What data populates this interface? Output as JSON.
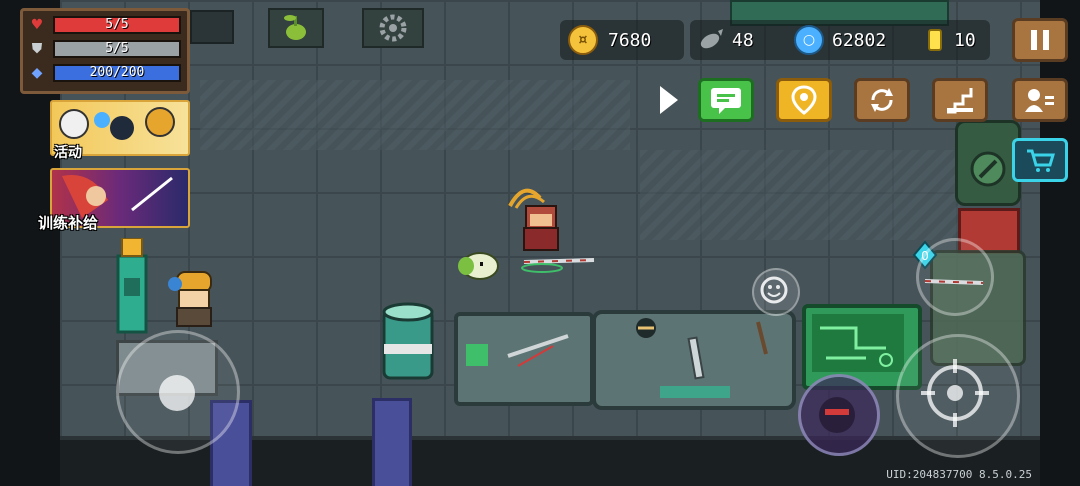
{
  "stats": {
    "hp": {
      "text": "5/5",
      "fraction": 1.0,
      "color": "#e03b3b",
      "icon": "heart-icon"
    },
    "armor": {
      "text": "5/5",
      "fraction": 1.0,
      "color": "#9aa2a6",
      "icon": "shield-icon"
    },
    "energy": {
      "text": "200/200",
      "fraction": 1.0,
      "color": "#3b6fe0",
      "icon": "diamond-icon"
    }
  },
  "events": {
    "activity_label": "活动",
    "training_label": "训练补给"
  },
  "resources": {
    "gold": "7680",
    "fish": "48",
    "gems": "62802",
    "tokens": "10"
  },
  "colors": {
    "gold": "#f5c33b",
    "gem": "#4ab0ff",
    "token": "#ffe14d",
    "accent_cyan": "#3ad3e8"
  },
  "top_buttons": {
    "pause": "pause-icon",
    "chat": "chat-icon",
    "location": "location-icon",
    "refresh": "refresh-icon",
    "stairs": "stairs-icon",
    "profile": "profile-icon",
    "shop": "cart-icon"
  },
  "footer": {
    "uid": "UID:204837700 8.5.0.25"
  }
}
